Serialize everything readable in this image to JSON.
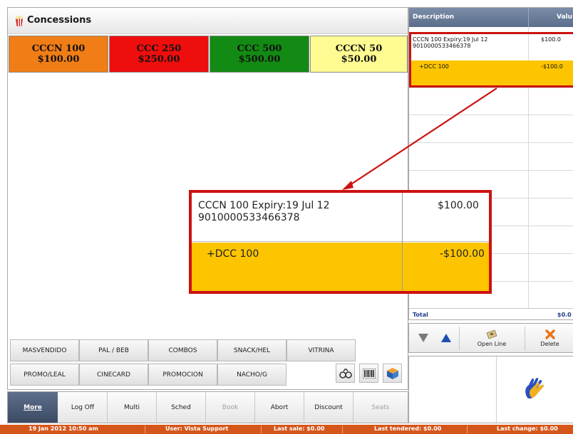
{
  "panel": {
    "title": "Concessions",
    "icon": "popcorn-icon"
  },
  "items": [
    {
      "name": "CCCN 100",
      "price": "$100.00",
      "bg": "#f07d16",
      "fg": "#111111"
    },
    {
      "name": "CCC 250",
      "price": "$250.00",
      "bg": "#ee0e0e",
      "fg": "#111111"
    },
    {
      "name": "CCC 500",
      "price": "$500.00",
      "bg": "#138a13",
      "fg": "#111111"
    },
    {
      "name": "CCCN 50",
      "price": "$50.00",
      "bg": "#fdfb91",
      "fg": "#111111"
    }
  ],
  "categories": {
    "row1": [
      "MASVENDIDO",
      "PAL / BEB",
      "COMBOS",
      "SNACK/HEL",
      "VITRINA"
    ],
    "row2": [
      "PROMO/LEAL",
      "CINECARD",
      "PROMOCION",
      "NACHO/G"
    ]
  },
  "tool_icons": [
    "binoculars-icon",
    "barcode-icon",
    "cube-icon"
  ],
  "order": {
    "col_description": "Description",
    "col_value": "Valu",
    "rows": [
      {
        "line1": "CCCN 100  Expiry:19 Jul 12",
        "line2": "9010000533466378",
        "value": "$100.0"
      },
      {
        "line1": "+DCC 100",
        "value": "-$100.0"
      }
    ],
    "total_label": "Total",
    "total_value": "$0.0"
  },
  "zoom": {
    "row1_line1": "CCCN 100  Expiry:19 Jul 12",
    "row1_line2": "9010000533466378",
    "row1_value": "$100.00",
    "row2_desc": "+DCC 100",
    "row2_value": "-$100.00"
  },
  "actions": {
    "open_line": "Open Line",
    "delete": "Delete"
  },
  "nav": [
    {
      "label": "More",
      "state": "active"
    },
    {
      "label": "Log Off",
      "state": "normal"
    },
    {
      "label": "Multi",
      "state": "normal"
    },
    {
      "label": "Sched",
      "state": "normal"
    },
    {
      "label": "Book",
      "state": "disabled"
    },
    {
      "label": "Abort",
      "state": "normal"
    },
    {
      "label": "Discount",
      "state": "normal"
    },
    {
      "label": "Seats",
      "state": "disabled"
    }
  ],
  "status": {
    "datetime": "19 Jan 2012 10:50 am",
    "user": "User: Vista Support",
    "last_sale": "Last sale: $0.00",
    "last_tendered": "Last tendered: $0.00",
    "last_change": "Last change: $0.00"
  },
  "colors": {
    "status_bar": "#d5561b",
    "highlight_row": "#fcc500",
    "callout_border": "#cc1111",
    "grid_header": "#6a7c98"
  }
}
